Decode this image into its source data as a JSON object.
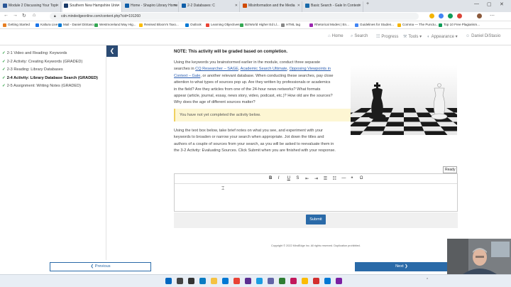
{
  "browser": {
    "tabs": [
      {
        "title": "Module 2 Discussing Your Topi",
        "active": false,
        "color": "#2b5797"
      },
      {
        "title": "Southern New Hampshire Univ",
        "active": true,
        "color": "#1b3a67"
      },
      {
        "title": "Home - Shapiro Library Home",
        "active": false,
        "color": "#0f5ea8"
      },
      {
        "title": "2-2 Databases: C",
        "active": false,
        "color": "#0f5ea8"
      },
      {
        "title": "Misinformation and the Media",
        "active": false,
        "color": "#d04a02"
      },
      {
        "title": "Basic Search - Gale In Context",
        "active": false,
        "color": "#1769aa"
      }
    ],
    "url": "cdn.mindedgeonline.com/content.php?cid=191260",
    "bookmarks": [
      {
        "label": "Getting Started",
        "color": "#e67e22"
      },
      {
        "label": "Kaltura Live",
        "color": "#1a73e8"
      },
      {
        "label": "Mail - Daniel DiStaso...",
        "color": "#0078d4"
      },
      {
        "label": "Westmoreland May Hig...",
        "color": "#34a853"
      },
      {
        "label": "Revised Bloom's Taxo...",
        "color": "#fbbc05"
      },
      {
        "label": "Outlook",
        "color": "#0078d4"
      },
      {
        "label": "Learning Objectives",
        "color": "#ea4335"
      },
      {
        "label": "BizWorld Higher Ed Ll...",
        "color": "#34a853"
      },
      {
        "label": "HTML tag",
        "color": "#888888"
      },
      {
        "label": "Rhetorical Modes | En...",
        "color": "#9c27b0"
      },
      {
        "label": "Guidelines for Studen...",
        "color": "#4285f4"
      },
      {
        "label": "Comma — The Punctu...",
        "color": "#f4b400"
      },
      {
        "label": "Top 10 Free Plagiarism...",
        "color": "#0f9d58"
      }
    ]
  },
  "header": {
    "nav": [
      {
        "icon": "home-icon",
        "glyph": "⌂",
        "label": "Home"
      },
      {
        "icon": "search-icon",
        "glyph": "⌕",
        "label": "Search"
      },
      {
        "icon": "progress-icon",
        "glyph": "☷",
        "label": "Progress"
      },
      {
        "icon": "tools-icon",
        "glyph": "⚒",
        "label": "Tools ▾"
      },
      {
        "icon": "appearance-icon",
        "glyph": "◐",
        "label": "Appearance ▾"
      },
      {
        "icon": "user-icon",
        "glyph": "☺",
        "label": "Daniel DiStasio"
      }
    ]
  },
  "sidebar": {
    "items": [
      {
        "label": "2-1 Video and Reading: Keywords",
        "active": false
      },
      {
        "label": "2-2 Activity: Creating Keywords (GRADED)",
        "active": false
      },
      {
        "label": "2-3 Reading: Library Databases",
        "active": false
      },
      {
        "label": "2-4 Activity: Library Database Search (GRADED)",
        "active": true
      },
      {
        "label": "2-5 Assignment: Writing Notes (GRADED)",
        "active": false
      }
    ],
    "collapse_glyph": "❮"
  },
  "content": {
    "note": "NOTE: This activity will be graded based on completion.",
    "p1_lines": [
      {
        "pre": "Using the keywords you brainstormed earlier in the module, conduct three separate",
        "links": []
      },
      {
        "pre": "searches in ",
        "links": [
          "CQ Researcher – SAGE",
          "Academic Search Ultimate",
          "Opposing Viewpoints in"
        ],
        "seps": [
          ", ",
          ", "
        ]
      },
      {
        "pre": "",
        "links": [
          "Context – Gale"
        ],
        "post": ", or another relevant database. When conducting these searches, pay close"
      },
      {
        "pre": "attention to what types of sources pop up. Are they written by professionals or academics",
        "links": []
      },
      {
        "pre": "in the field? Are they articles from one of the 24-hour news networks? What formats",
        "links": []
      },
      {
        "pre": "appear (article, journal, essay, news story, video, podcast, etc.)? How old are the sources?",
        "links": []
      },
      {
        "pre": "Why does the age of different sources matter?",
        "links": []
      }
    ],
    "alert": "You have not yet completed the activity below.",
    "p2_lines": [
      "Using the text box below, take brief notes on what you see, and experiment with your",
      "keywords to broaden or narrow your search when appropriate. Jot down the titles and",
      "authors of a couple of sources from your search, as you will be asked to reevaluate them in",
      "the 3-2 Activity: Evaluating Sources. Click Submit when you are finished with your response."
    ],
    "ready": "Ready",
    "toolbar": [
      "B",
      "I",
      "U",
      "S",
      "⇤",
      "⇥",
      "☰",
      "☷",
      "—",
      "❝",
      "Ω"
    ],
    "submit": "Submit",
    "copyright": "Copyright © 2022 MindEdge Inc. All rights reserved. Duplication prohibited."
  },
  "footer": {
    "previous": "❮ Previous",
    "next": "Next ❯"
  }
}
